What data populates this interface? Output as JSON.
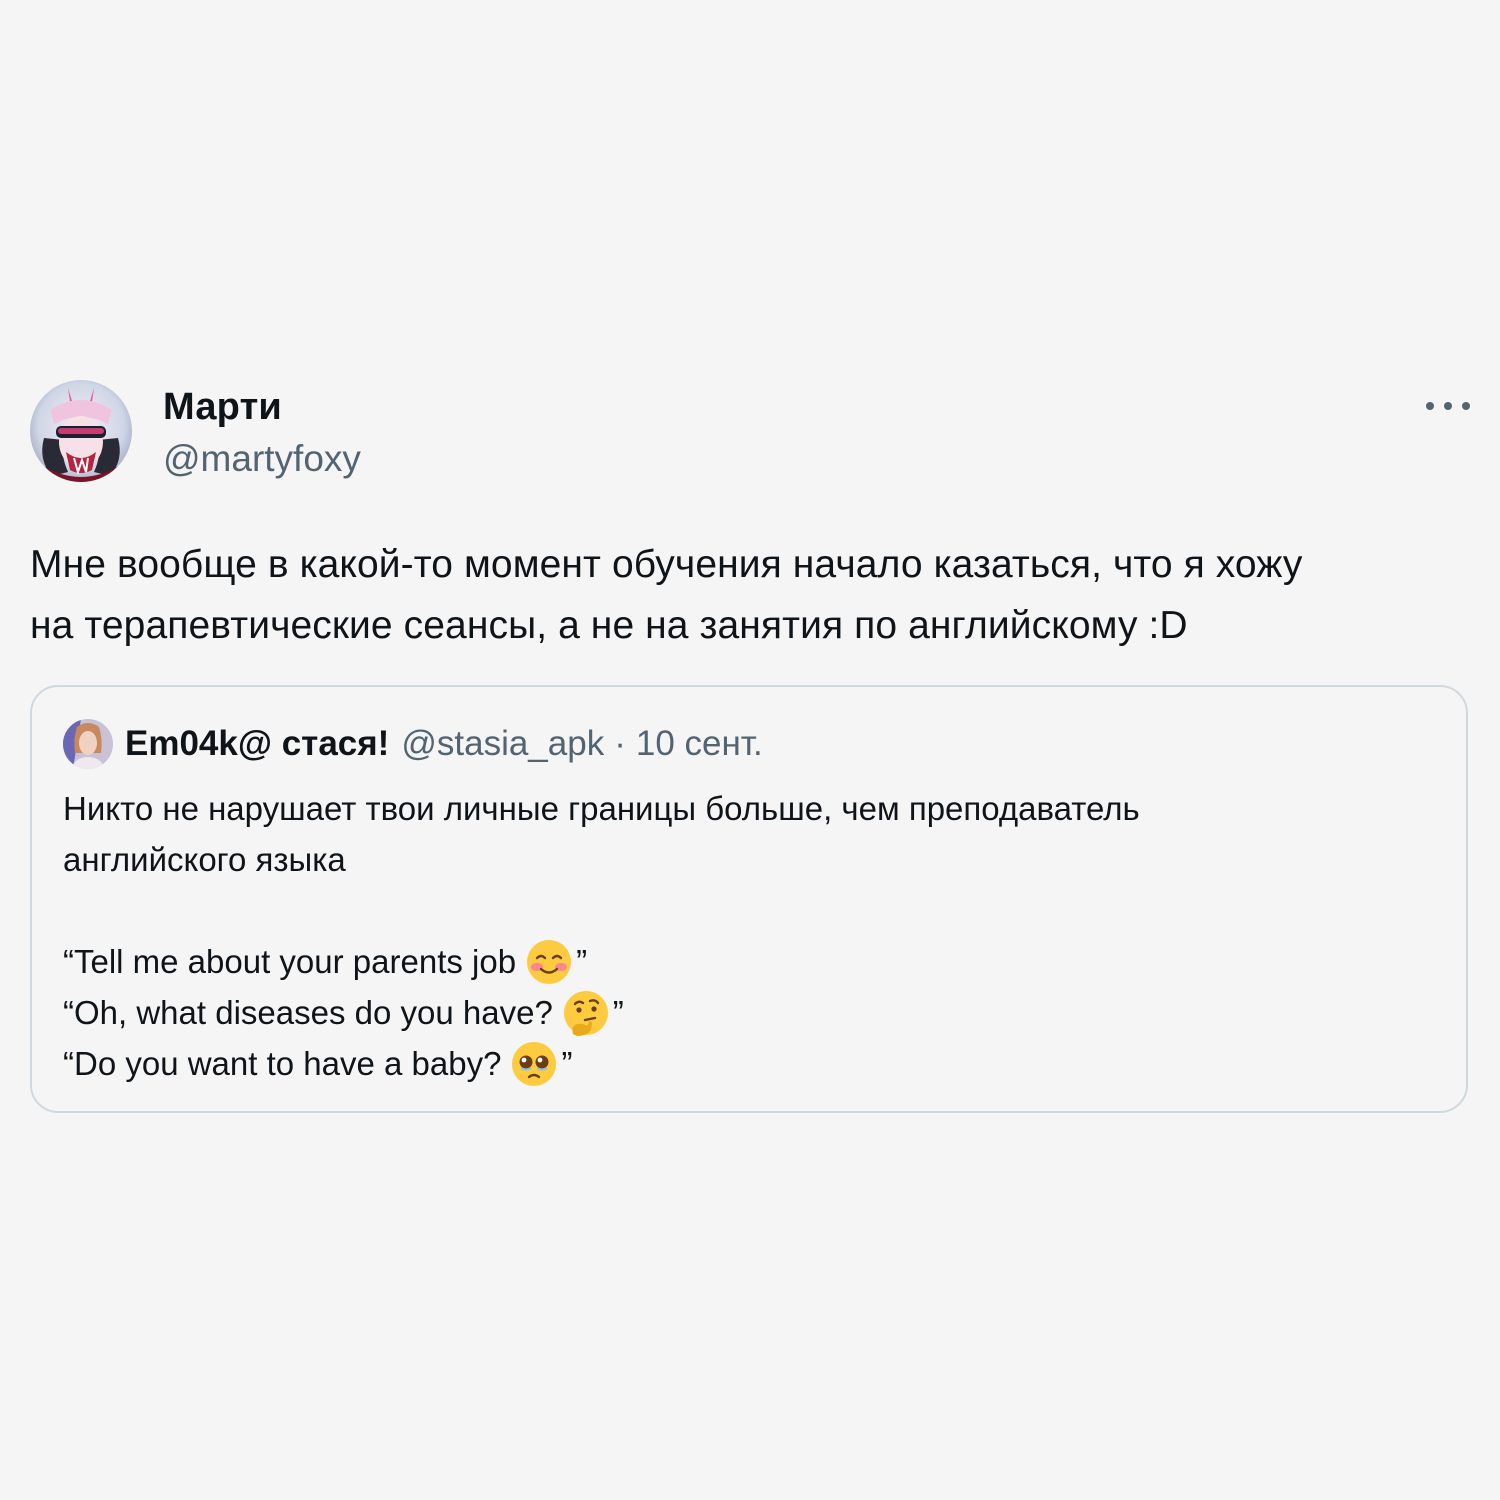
{
  "tweet": {
    "display_name": "Марти",
    "handle": "@martyfoxy",
    "text": "Мне вообще в какой-то момент обучения начало казаться, что я хожу\nна терапевтические сеансы, а не на занятия по английскому :D",
    "avatar_icon": "avatar-anime-character",
    "more_icon": "more-options-icon"
  },
  "quote": {
    "display_name": "Em04k@ стася!",
    "handle": "@stasia_apk",
    "separator": "·",
    "date": "10 сент.",
    "text_line1": "Никто не нарушает твои личные границы больше, чем преподаватель",
    "text_line2": "английского языка",
    "lines": [
      {
        "prefix": "“Tell me about your parents job",
        "suffix": "”",
        "emoji": "smiling-face-with-blush-icon"
      },
      {
        "prefix": "“Oh, what diseases do you have?",
        "suffix": "”",
        "emoji": "thinking-face-icon"
      },
      {
        "prefix": "“Do you want to have a baby?",
        "suffix": "”",
        "emoji": "pleading-face-icon"
      }
    ]
  },
  "colors": {
    "background": "#f5f5f6",
    "text": "#0f1419",
    "secondary": "#536471",
    "border": "#cfd9de",
    "emoji_yellow": "#fdcb3f"
  }
}
